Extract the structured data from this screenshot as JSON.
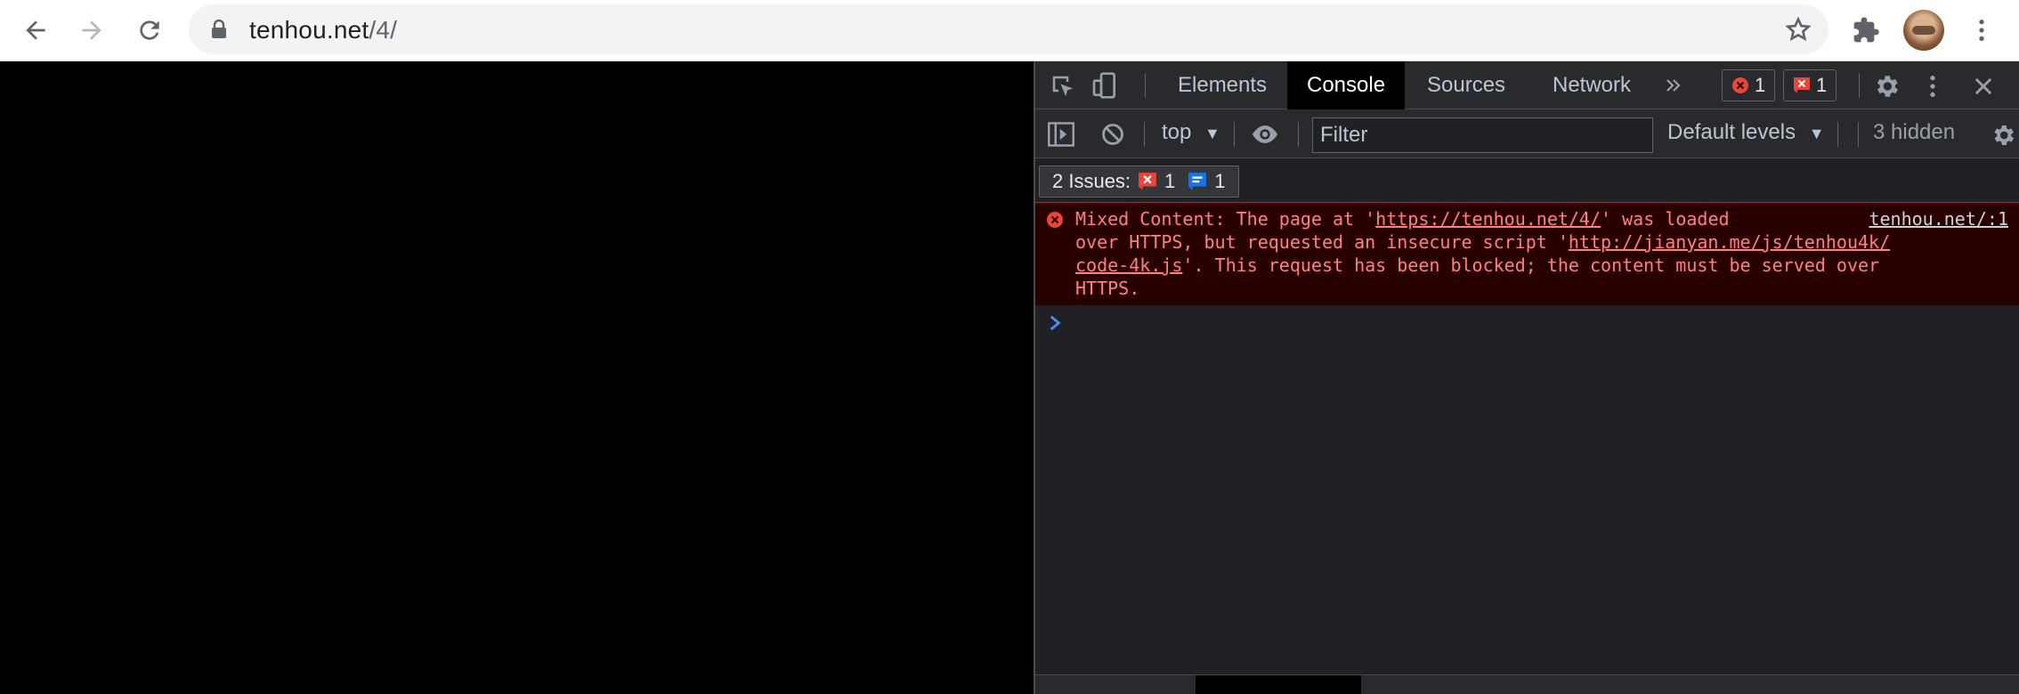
{
  "browser": {
    "url_host": "tenhou.net",
    "url_path": "/4/"
  },
  "devtools": {
    "tabs": [
      {
        "label": "Elements"
      },
      {
        "label": "Console"
      },
      {
        "label": "Sources"
      },
      {
        "label": "Network"
      }
    ],
    "active_tab": "Console",
    "error_count": "1",
    "issue_count": "1",
    "context": "top",
    "filter_placeholder": "Filter",
    "levels": "Default levels",
    "hidden": "3 hidden",
    "issues": {
      "label": "2 Issues:",
      "error_count": "1",
      "info_count": "1"
    },
    "message": {
      "line1_pre": "Mixed Content: The page at '",
      "line1_link": "https://tenhou.net/4/",
      "line1_post": "' was loaded",
      "line2_pre": "over HTTPS, but requested an insecure script '",
      "line2_link": "http://jianyan.me/js/tenhou4k/",
      "line3_link": "code-4k.js",
      "line3_post": "'. This request has been blocked; the content must be served over",
      "line4": "HTTPS.",
      "source": "tenhou.net/:1"
    }
  },
  "colors": {
    "error_red": "#e8453c",
    "info_blue": "#1a73e8",
    "console_error_bg": "#290000",
    "console_error_text": "#ff8080"
  }
}
